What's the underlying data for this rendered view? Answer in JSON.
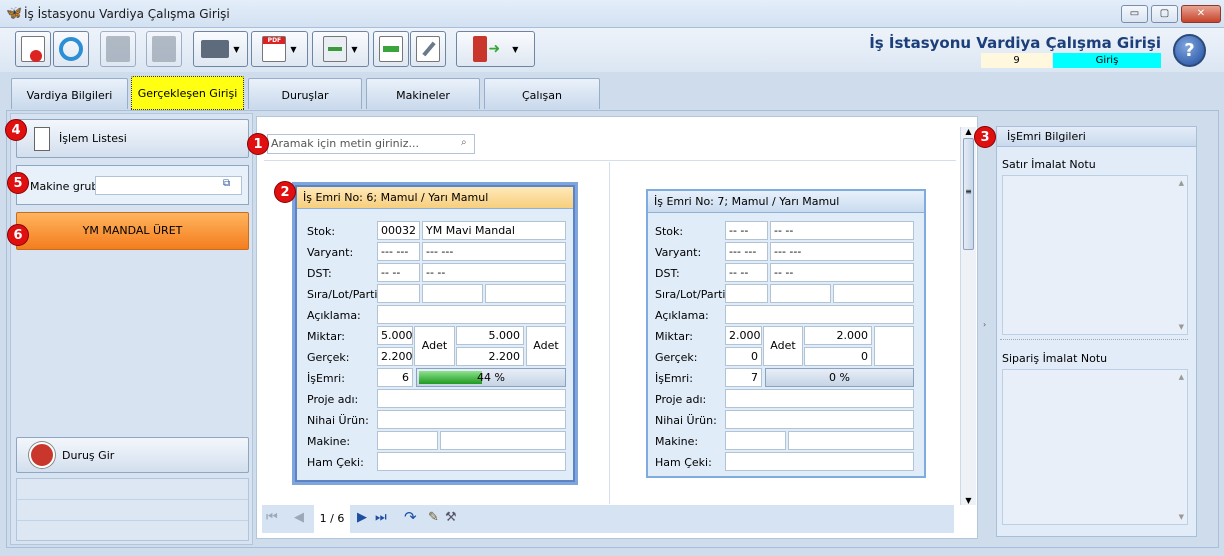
{
  "window": {
    "title": "İş İstasyonu Vardiya Çalışma Girişi",
    "min": "▭",
    "max": "▢",
    "close": "✕"
  },
  "header": {
    "app_title": "İş İstasyonu Vardiya Çalışma Girişi",
    "shift_no": "9",
    "mode": "Giriş",
    "help": "?"
  },
  "tabs": [
    "Vardiya Bilgileri",
    "Gerçekleşen Girişi",
    "Duruşlar",
    "Makineler",
    "Çalışan"
  ],
  "left": {
    "islem_listesi": "İşlem Listesi",
    "makine_grubu_label": "Makine grubu",
    "makine_grubu_value": "",
    "ym_button": "YM MANDAL ÜRET",
    "durus_button": "Duruş Gir"
  },
  "badges": [
    "1",
    "2",
    "3",
    "4",
    "5",
    "6"
  ],
  "search": {
    "placeholder": "Aramak için metin giriniz..."
  },
  "labels": {
    "stok": "Stok:",
    "varyant": "Varyant:",
    "dst": "DST:",
    "sira": "Sıra/Lot/Parti:",
    "aciklama": "Açıklama:",
    "miktar": "Miktar:",
    "gercek": "Gerçek:",
    "isemri": "İşEmri:",
    "proje": "Proje adı:",
    "nihai": "Nihai Ürün:",
    "makine": "Makine:",
    "ham": "Ham Çeki:"
  },
  "cards": [
    {
      "title": "İş Emri No: 6; Mamul / Yarı Mamul",
      "stok_code": "00032",
      "stok_name": "YM Mavi Mandal",
      "varyant1": "--- ---",
      "varyant2": "--- ---",
      "dst1": "-- --",
      "dst2": "-- --",
      "miktar": "5.000",
      "miktar_unit": "Adet",
      "miktar2": "5.000",
      "miktar_unit2": "Adet",
      "gercek": "2.200",
      "gercek2": "2.200",
      "isemri_no": "6",
      "progress_text": "44 %",
      "progress": 0.44
    },
    {
      "title": "İş Emri No: 7; Mamul / Yarı Mamul",
      "stok_code": "-- --",
      "stok_name": "-- --",
      "varyant1": "--- ---",
      "varyant2": "--- ---",
      "dst1": "-- --",
      "dst2": "-- --",
      "miktar": "2.000",
      "miktar_unit": "Adet",
      "miktar2": "2.000",
      "gercek": "0",
      "gercek2": "0",
      "isemri_no": "7",
      "progress_text": "0 %",
      "progress": 0
    }
  ],
  "right": {
    "title": "İşEmri Bilgileri",
    "satir_notu": "Satır İmalat Notu",
    "siparis_notu": "Sipariş İmalat Notu"
  },
  "pager": {
    "page": "1 / 6"
  },
  "colors": {
    "accent": "#1c3f7a",
    "active_tab": "#ffff12",
    "orange": "#f47d1e",
    "progress": "#2fae2f",
    "badge": "#e01010"
  }
}
